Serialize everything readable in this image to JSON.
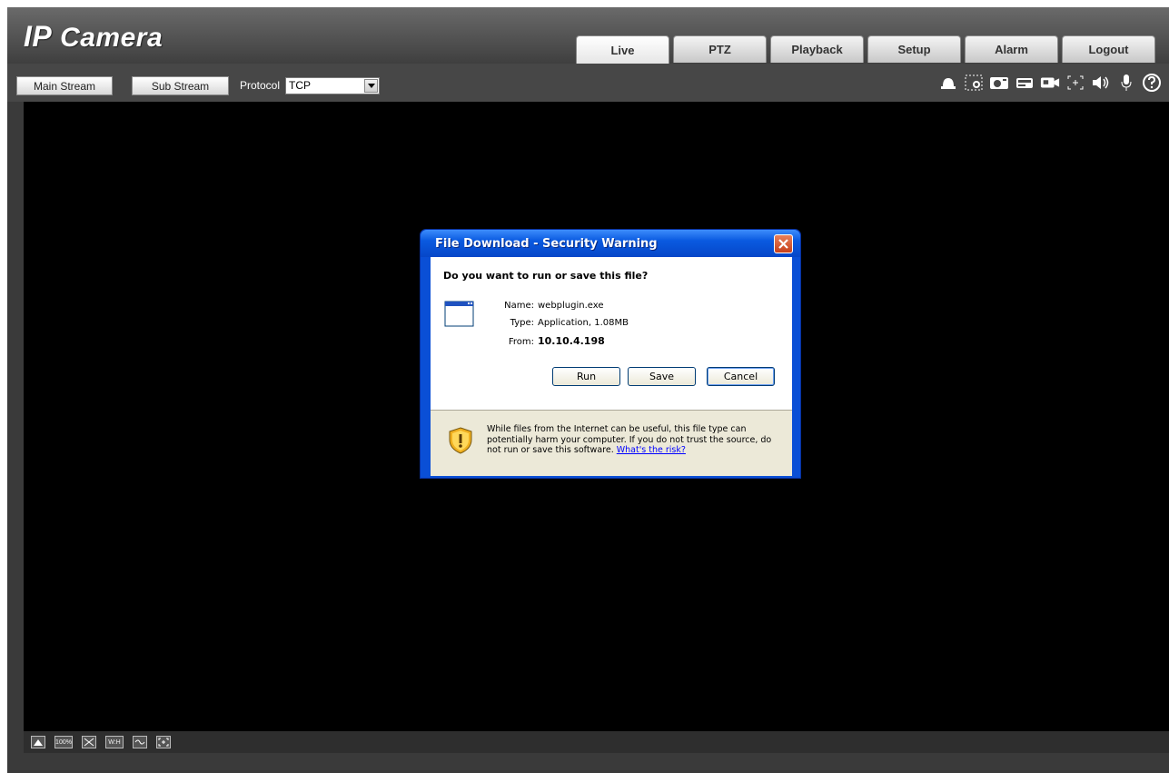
{
  "app": {
    "logo_prefix": "IP",
    "logo_suffix": " Camera"
  },
  "tabs": [
    {
      "label": "Live"
    },
    {
      "label": "PTZ"
    },
    {
      "label": "Playback"
    },
    {
      "label": "Setup"
    },
    {
      "label": "Alarm"
    },
    {
      "label": "Logout"
    }
  ],
  "toolbar": {
    "main_stream_label": "Main Stream",
    "sub_stream_label": "Sub Stream",
    "protocol_label": "Protocol",
    "protocol_value": "TCP",
    "icons": [
      "alarm-bell-icon",
      "zoom-region-icon",
      "snapshot-icon",
      "triple-snapshot-icon",
      "record-icon",
      "fullscreen-icon",
      "speaker-icon",
      "microphone-icon",
      "help-icon"
    ]
  },
  "bottom_bar": {
    "icons": [
      "original-size-icon",
      "zoom-100-icon",
      "fit-window-icon",
      "aspect-ratio-icon",
      "smooth-icon",
      "fullscreen-view-icon"
    ],
    "zoom_100_label": "100%",
    "aspect_label": "W:H"
  },
  "dialog": {
    "title": "File Download - Security Warning",
    "question": "Do you want to run or save this file?",
    "name_key": "Name:",
    "name_value": "webplugin.exe",
    "type_key": "Type:",
    "type_value": "Application, 1.08MB",
    "from_key": "From:",
    "from_value": "10.10.4.198",
    "run_label": "Run",
    "save_label": "Save",
    "cancel_label": "Cancel",
    "warning_text": "While files from the Internet can be useful, this file type can potentially harm your computer. If you do not trust the source, do not run or save this software. ",
    "risk_link": "What's the risk?"
  },
  "colors": {
    "header_bg": "#4a4a4a",
    "video_bg": "#000000",
    "xp_title_blue": "#0a5ae0",
    "xp_dialog_bg": "#ece9d8"
  }
}
